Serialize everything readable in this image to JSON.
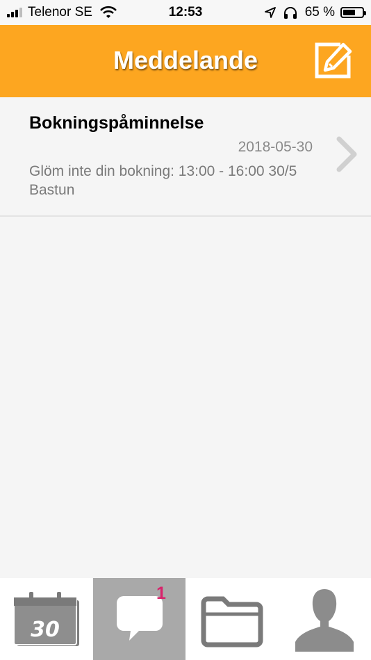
{
  "status_bar": {
    "carrier": "Telenor SE",
    "time": "12:53",
    "battery_text": "65 %",
    "battery_level": 0.65
  },
  "header": {
    "title": "Meddelande",
    "compose_icon": "compose-icon"
  },
  "messages": [
    {
      "subject": "Bokningspåminnelse",
      "date": "2018-05-30",
      "body": "Glöm inte din bokning: 13:00 - 16:00 30/5 Bastun"
    }
  ],
  "tabbar": {
    "calendar_number": "30",
    "messages_badge": "1",
    "active_tab": "messages"
  },
  "colors": {
    "header_bg": "#fda620",
    "active_tab_bg": "#a9a9a9",
    "badge": "#d8236b"
  }
}
